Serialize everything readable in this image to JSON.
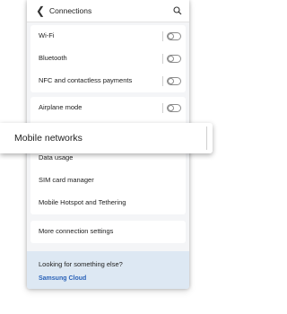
{
  "header": {
    "title": "Connections",
    "back_icon": "chevron-left-icon",
    "search_icon": "search-icon"
  },
  "group1": [
    {
      "label": "Wi-Fi",
      "toggle": false
    },
    {
      "label": "Bluetooth",
      "toggle": false
    },
    {
      "label": "NFC and contactless payments",
      "toggle": false
    }
  ],
  "group2": [
    {
      "label": "Airplane mode",
      "toggle": false
    }
  ],
  "highlight": {
    "label": "Mobile networks"
  },
  "group3": [
    {
      "label": "Data usage"
    },
    {
      "label": "SIM card manager"
    },
    {
      "label": "Mobile Hotspot and Tethering"
    }
  ],
  "group4": [
    {
      "label": "More connection settings"
    }
  ],
  "looking": {
    "title": "Looking for something else?",
    "link": "Samsung Cloud"
  },
  "colors": {
    "background": "#f4f5f7",
    "link": "#2a62b8",
    "looking_bg": "#dde8f3"
  }
}
